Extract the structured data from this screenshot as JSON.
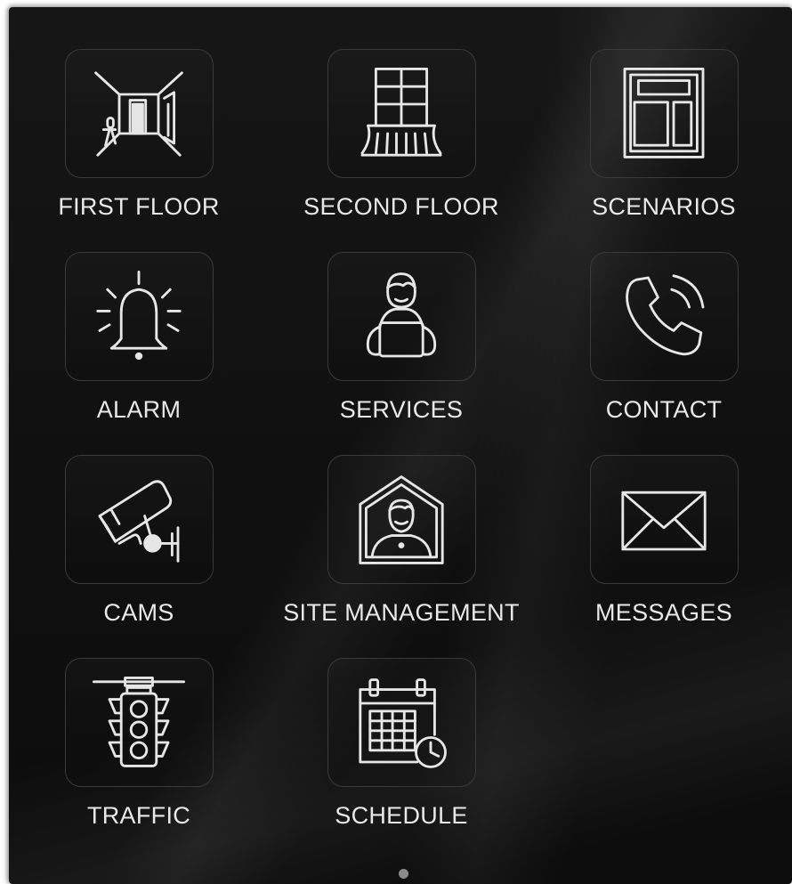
{
  "tiles": [
    {
      "id": "first-floor",
      "label": "FIRST FLOOR",
      "icon": "room-door-icon"
    },
    {
      "id": "second-floor",
      "label": "SECOND FLOOR",
      "icon": "balcony-window-icon"
    },
    {
      "id": "scenarios",
      "label": "SCENARIOS",
      "icon": "layout-panel-icon"
    },
    {
      "id": "alarm",
      "label": "ALARM",
      "icon": "alarm-bell-icon"
    },
    {
      "id": "services",
      "label": "SERVICES",
      "icon": "person-laptop-icon"
    },
    {
      "id": "contact",
      "label": "CONTACT",
      "icon": "phone-call-icon"
    },
    {
      "id": "cams",
      "label": "CAMS",
      "icon": "security-camera-icon"
    },
    {
      "id": "site-management",
      "label": "SITE MANAGEMENT",
      "icon": "house-person-icon"
    },
    {
      "id": "messages",
      "label": "MESSAGES",
      "icon": "envelope-icon"
    },
    {
      "id": "traffic",
      "label": "TRAFFIC",
      "icon": "traffic-light-icon"
    },
    {
      "id": "schedule",
      "label": "SCHEDULE",
      "icon": "calendar-clock-icon"
    }
  ],
  "pagination": {
    "pages": 1,
    "current": 1
  },
  "colors": {
    "background": "#121212",
    "icon_stroke": "#e6e6e6",
    "label": "#e8e8e8",
    "tile_border": "#3a3a3a"
  }
}
